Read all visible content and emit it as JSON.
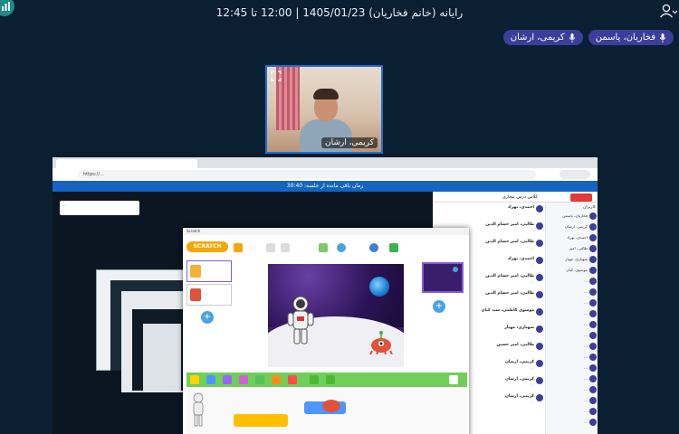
{
  "header": {
    "session_title": "رایانه (خانم فخاریان) 1405/01/23 | 12:00 تا 12:45"
  },
  "participants": [
    {
      "name": "فخاریان، یاسمن"
    },
    {
      "name": "کریمی، ارشان"
    }
  ],
  "video": {
    "name": "کریمی، ارشان"
  },
  "browser": {
    "url": "https://...",
    "timer": "زمان باقی مانده از جلسه: 30:40",
    "note": "..."
  },
  "classroom": {
    "header": "کلاس درس مجازی",
    "logo": "",
    "users_title": "کاربران",
    "messages": [
      {
        "sender": "احمدی، بهراد",
        "body": "..."
      },
      {
        "sender": "طالبی، امیر حسام الدین",
        "body": "..."
      },
      {
        "sender": "طالبی، امیر حسام الدین",
        "body": "..."
      },
      {
        "sender": "احمدی، بهراد",
        "body": "..."
      },
      {
        "sender": "طالبی، امیر حسام الدین",
        "body": "..."
      },
      {
        "sender": "طالبی، امیر حسام الدین",
        "body": "..."
      },
      {
        "sender": "موسوی کاظمی، سید کیان",
        "body": "..."
      },
      {
        "sender": "شهبازی، مهیار",
        "body": "..."
      },
      {
        "sender": "طالبی، امیر حسین",
        "body": "..."
      },
      {
        "sender": "کریمی، ارشان",
        "body": "..."
      },
      {
        "sender": "کریمی، ارشان",
        "body": "..."
      },
      {
        "sender": "کریمی، ارشان",
        "body": "..."
      }
    ],
    "users": [
      {
        "name": "فخاریان، یاسمن"
      },
      {
        "name": "کریمی، ارشان"
      },
      {
        "name": "احمدی، بهراد"
      },
      {
        "name": "طالبی، امیر"
      },
      {
        "name": "شهبازی، مهیار"
      },
      {
        "name": "موسوی، کیان"
      },
      {
        "name": "..."
      },
      {
        "name": "..."
      },
      {
        "name": "..."
      },
      {
        "name": "..."
      },
      {
        "name": "..."
      },
      {
        "name": "..."
      },
      {
        "name": "..."
      },
      {
        "name": "..."
      },
      {
        "name": "..."
      },
      {
        "name": "..."
      },
      {
        "name": "..."
      },
      {
        "name": "..."
      },
      {
        "name": "..."
      },
      {
        "name": "..."
      }
    ]
  },
  "scratch": {
    "window_title": "Scratch",
    "logo": "SCRATCH",
    "sprites": [
      {
        "name": "..."
      },
      {
        "name": "..."
      }
    ],
    "add_sprite": "+",
    "add_backdrop": "+"
  },
  "colors": {
    "background": "#0b1f33",
    "chip": "#3b3f9a",
    "accent_teal": "#1f8a86",
    "tile_border": "#1a6fd6",
    "timer_bar": "#1565c0",
    "scratch_green": "#6fcf59",
    "scratch_stage": "#3b1e6b"
  }
}
